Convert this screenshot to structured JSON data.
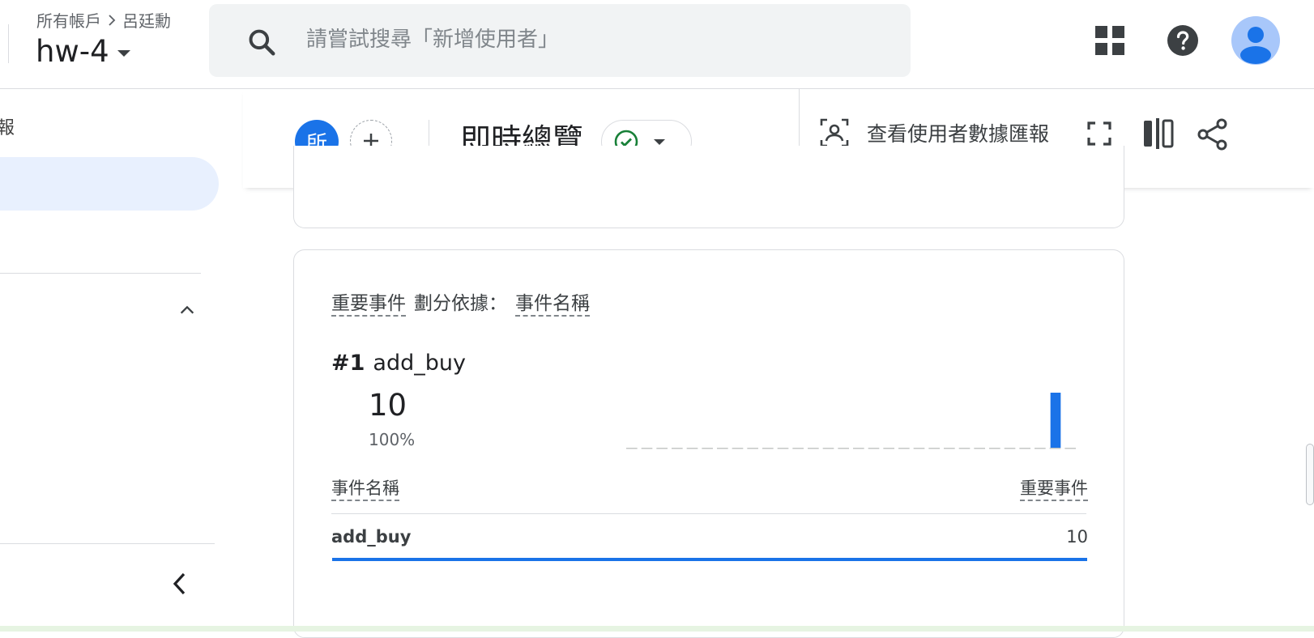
{
  "header": {
    "breadcrumb": {
      "root": "所有帳戶",
      "account": "呂廷勳"
    },
    "property": "hw-4",
    "search_placeholder": "請嘗試搜尋「新增使用者」"
  },
  "sidebar": {
    "fragment_text": "報"
  },
  "report_header": {
    "comparison_chip": "所",
    "title": "即時總覽",
    "view_user_snapshot": "查看使用者數據匯報"
  },
  "card": {
    "title_metric": "重要事件",
    "title_by": "劃分依據：",
    "title_dimension": "事件名稱",
    "top_rank": "#1",
    "top_name": "add_buy",
    "top_value": "10",
    "top_percent": "100%",
    "table": {
      "col_left": "事件名稱",
      "col_right": "重要事件",
      "rows": [
        {
          "name": "add_buy",
          "value": "10",
          "share": 1.0
        }
      ]
    }
  },
  "chart_data": {
    "type": "bar",
    "bars": 30,
    "values": [
      0,
      0,
      0,
      0,
      0,
      0,
      0,
      0,
      0,
      0,
      0,
      0,
      0,
      0,
      0,
      0,
      0,
      0,
      0,
      0,
      0,
      0,
      0,
      0,
      0,
      0,
      0,
      0,
      10,
      0
    ],
    "color": "#1a73e8"
  },
  "colors": {
    "accent": "#1a73e8",
    "status_ok": "#188038",
    "avatar_bg": "#a8c7fa"
  }
}
